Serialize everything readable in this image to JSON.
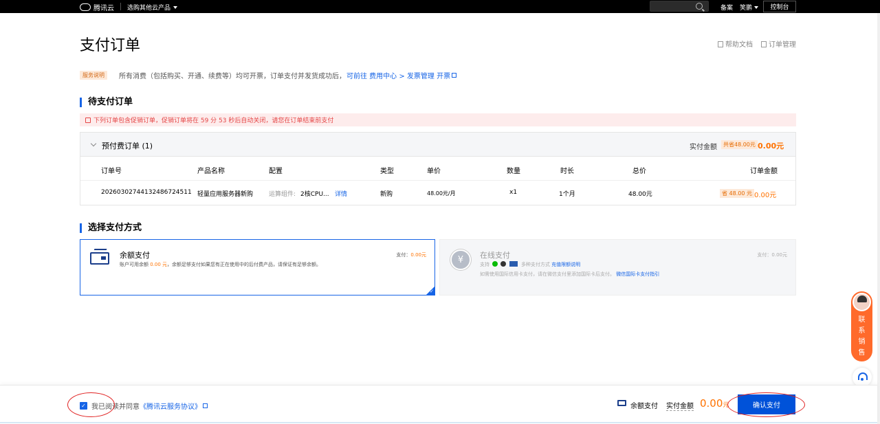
{
  "topbar": {
    "brand": "腾讯云",
    "products_label": "选购其他云产品",
    "beian": "备案",
    "user_name": "笑鹏",
    "console": "控制台"
  },
  "page": {
    "title": "支付订单",
    "help_doc": "帮助文档",
    "order_manage": "订单管理"
  },
  "notice": {
    "tag": "服务说明",
    "text": "所有消费（包括购买、开通、续费等）均可开票，订单支付并发货成功后，",
    "link_text": "可前往 费用中心 > 发票管理 开票"
  },
  "pending": {
    "section_title": "待支付订单",
    "warning": "下列订单包含促销订单，促销订单将在 59 分 53 秒后自动关闭，请您在订单结束前支付",
    "group_label": "预付费订单 (1)",
    "actual_label": "实付金额",
    "saving_tag": "共省48.00元",
    "actual_amount": "0.00元",
    "columns": {
      "order_no": "订单号",
      "product": "产品名称",
      "config": "配置",
      "type": "类型",
      "unit_price": "单价",
      "quantity": "数量",
      "duration": "时长",
      "total": "总价",
      "order_amount": "订单金额"
    },
    "row": {
      "order_no": "20260302744132486724511",
      "product": "轻量应用服务器新购",
      "config_label": "运算组件:",
      "config_value": "2核CPU...",
      "detail_link": "详情",
      "type": "新购",
      "unit_price": "48.00元/月",
      "quantity": "x1",
      "duration": "1个月",
      "total": "48.00元",
      "saving": "省 48.00 元",
      "order_amount": "0.00元"
    }
  },
  "payment": {
    "section_title": "选择支付方式",
    "balance": {
      "title": "余额支付",
      "desc_prefix": "账户可用余额",
      "balance_value": "0.00 元",
      "desc_suffix": "，余额足够支付如果您有正在使用中的后付费产品，请保证有足够余额。",
      "pay_label": "支付：",
      "pay_amount": "0.00元"
    },
    "online": {
      "title": "在线支付",
      "support_label": "支持",
      "methods_text": "多种支付方式",
      "quota_link": "充值限额说明",
      "intl_text": "如需使用国际信用卡支付，请在微信支付里添加国际卡后支付。",
      "intl_link": "微信国际卡支付指引",
      "pay_label": "支付：",
      "pay_amount": "0.00元"
    }
  },
  "float_contact": {
    "label_1": "联",
    "label_2": "系",
    "label_3": "销",
    "label_4": "售"
  },
  "bottom": {
    "agree_prefix": "我已阅读并同意",
    "agree_link": "《腾讯云服务协议》",
    "pay_method": "余额支付",
    "actual_label": "实付金额",
    "amount": "0.00",
    "amount_unit": "元",
    "confirm_button": "确认支付"
  },
  "colors": {
    "accent": "#1664e6",
    "price": "#ff7200",
    "warning": "#e54545",
    "confirm": "#0052d9"
  }
}
